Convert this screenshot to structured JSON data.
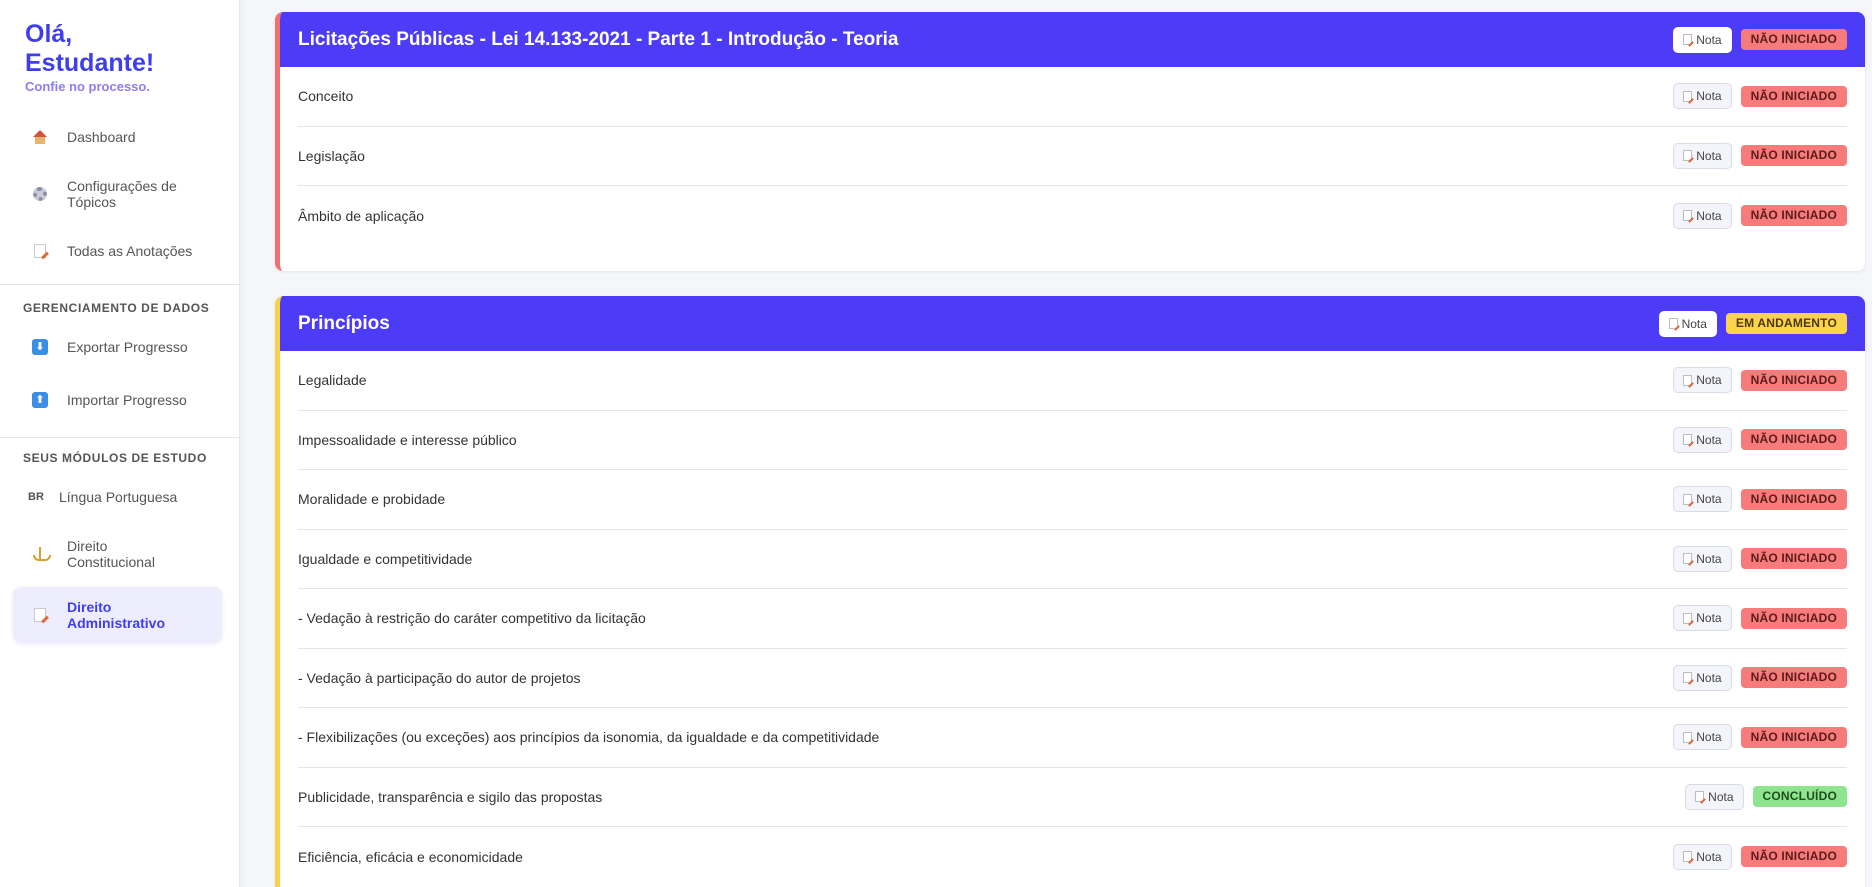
{
  "sidebar": {
    "greeting": "Olá, Estudante!",
    "motto": "Confie no processo.",
    "nav": [
      {
        "label": "Dashboard",
        "icon": "house-icon"
      },
      {
        "label": "Configurações de Tópicos",
        "icon": "gear-icon"
      },
      {
        "label": "Todas as Anotações",
        "icon": "memo-icon"
      }
    ],
    "data_section_title": "GERENCIAMENTO DE DADOS",
    "data_nav": [
      {
        "label": "Exportar Progresso",
        "icon": "arrow-down-icon",
        "glyph": "⬇"
      },
      {
        "label": "Importar Progresso",
        "icon": "arrow-up-icon",
        "glyph": "⬆"
      }
    ],
    "modules_section_title": "SEUS MÓDULOS DE ESTUDO",
    "modules": [
      {
        "label": "Língua Portuguesa",
        "icon": "br-flag-icon",
        "glyph": "BR"
      },
      {
        "label": "Direito Constitucional",
        "icon": "scale-icon"
      },
      {
        "label": "Direito Administrativo",
        "icon": "memo-icon",
        "active": true
      }
    ]
  },
  "cards": [
    {
      "title": "Licitações Públicas - Lei 14.133-2021 - Parte 1 - Introdução - Teoria",
      "nota_label": "Nota",
      "status": "NÃO INICIADO",
      "rows": [
        {
          "text": "Conceito",
          "status": "NÃO INICIADO"
        },
        {
          "text": "Legislação",
          "status": "NÃO INICIADO"
        },
        {
          "text": "Âmbito de aplicação",
          "status": "NÃO INICIADO"
        }
      ]
    },
    {
      "title": "Princípios",
      "nota_label": "Nota",
      "status": "EM ANDAMENTO",
      "rows": [
        {
          "text": "Legalidade",
          "status": "NÃO INICIADO"
        },
        {
          "text": "Impessoalidade e interesse público",
          "status": "NÃO INICIADO"
        },
        {
          "text": "Moralidade e probidade",
          "status": "NÃO INICIADO"
        },
        {
          "text": "Igualdade e competitividade",
          "status": "NÃO INICIADO"
        },
        {
          "text": "- Vedação à restrição do caráter competitivo da licitação",
          "status": "NÃO INICIADO"
        },
        {
          "text": "- Vedação à participação do autor de projetos",
          "status": "NÃO INICIADO"
        },
        {
          "text": "- Flexibilizações (ou exceções) aos princípios da isonomia, da igualdade e da competitividade",
          "status": "NÃO INICIADO"
        },
        {
          "text": "Publicidade, transparência e sigilo das propostas",
          "status": "CONCLUÍDO"
        },
        {
          "text": "Eficiência, eficácia e economicidade",
          "status": "NÃO INICIADO"
        }
      ]
    }
  ],
  "colors": {
    "accent": "#4c3cf7",
    "status_not_started": "#f77b7b",
    "status_in_progress": "#fcd34d",
    "status_done": "#8fe48f"
  }
}
